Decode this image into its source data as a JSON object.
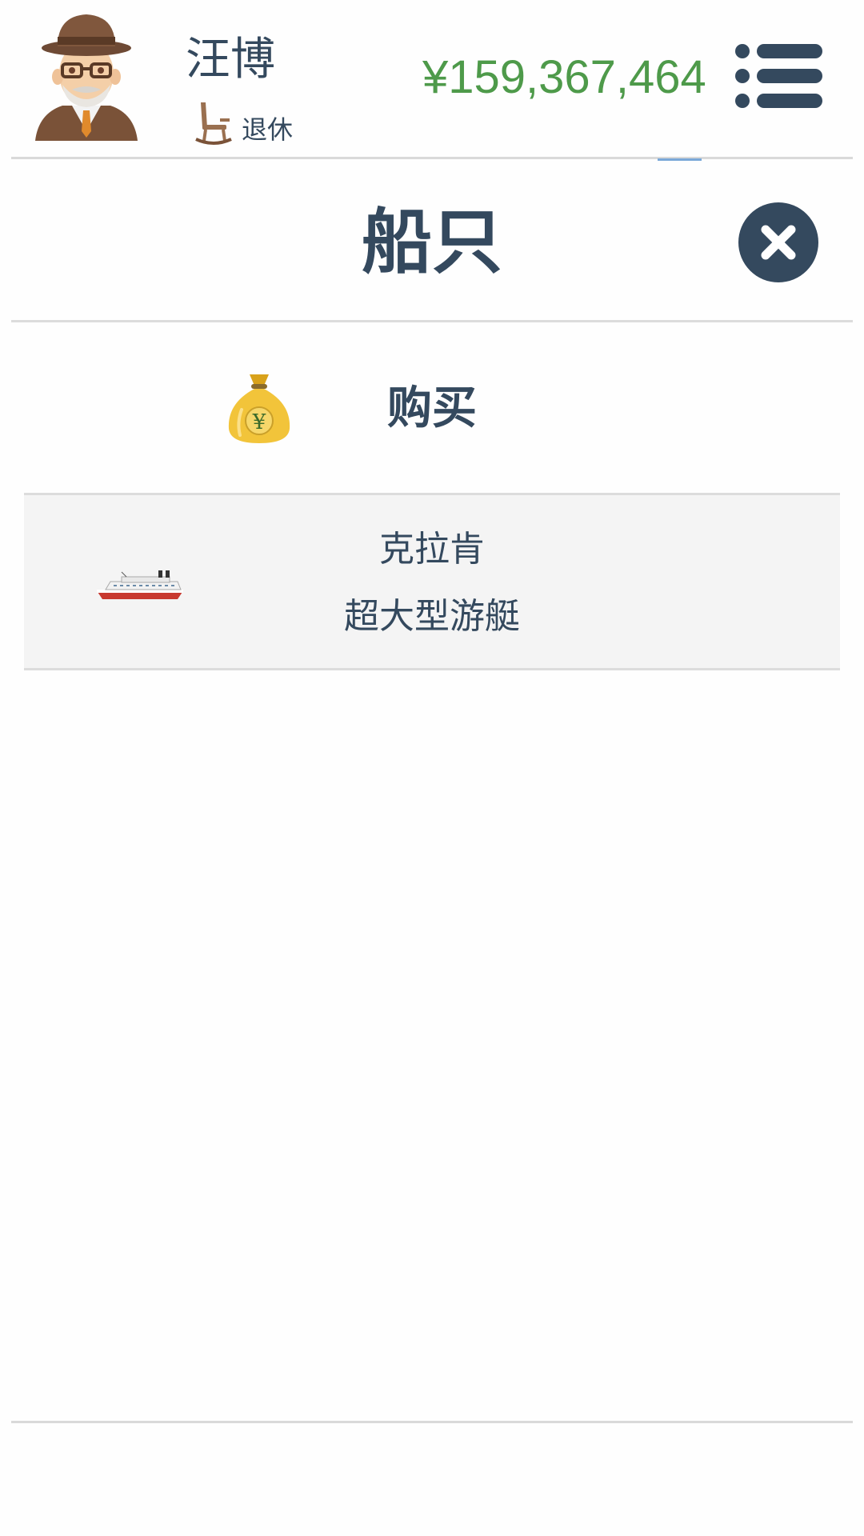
{
  "header": {
    "player_name": "汪博",
    "status_label": "退休",
    "money": "¥159,367,464",
    "money_color": "#4e9a4a",
    "avatar_icon": "old-man-avatar-icon",
    "status_icon": "rocking-chair-icon",
    "menu_icon": "list-menu-icon"
  },
  "page": {
    "title": "船只",
    "close_icon": "close-icon"
  },
  "buy": {
    "label": "购买",
    "icon": "money-bag-yuan-icon"
  },
  "ships": [
    {
      "name": "克拉肯",
      "type": "超大型游艇",
      "icon": "yacht-icon"
    }
  ],
  "colors": {
    "text": "#34495e",
    "row_background": "#f4f4f4",
    "divider": "#dcdcdc"
  }
}
